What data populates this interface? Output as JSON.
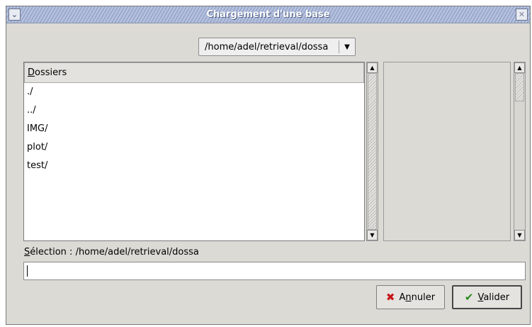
{
  "window": {
    "title": "Chargement d'une base",
    "menu_icon": "chevron-down-icon",
    "close_icon": "close-icon"
  },
  "path_combo": {
    "value": "/home/adel/retrieval/dossa"
  },
  "directories": {
    "header_first": "D",
    "header_rest": "ossiers",
    "items": [
      "./",
      "../",
      "IMG/",
      "plot/",
      "test/"
    ]
  },
  "selection": {
    "label_first": "S",
    "label_rest": "élection : /home/adel/retrieval/dossa",
    "value": ""
  },
  "buttons": {
    "cancel_pre": "A",
    "cancel_mn": "n",
    "cancel_post": "nuler",
    "ok_mn": "V",
    "ok_post": "alider"
  }
}
